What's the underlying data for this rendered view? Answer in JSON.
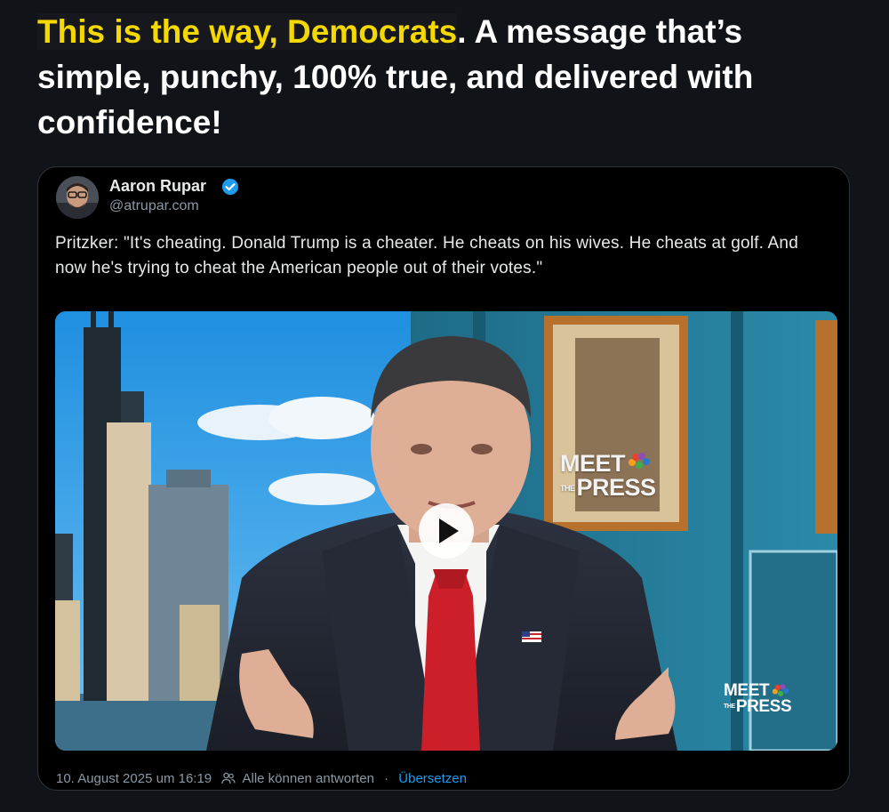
{
  "headline": {
    "highlight": "This is the way, Democrats",
    "rest": ". A message that’s simple, punchy, 100% true, and delivered with confidence!"
  },
  "post": {
    "author_name": "Aaron Rupar",
    "author_handle": "@atrupar.com",
    "verified": true,
    "text": "Pritzker: \"It's cheating. Donald Trump is a cheater. He cheats on his wives. He cheats at golf. And now he's trying to cheat the American people out of their votes.\"",
    "video": {
      "logo_line1": "MEET",
      "logo_the": "THE",
      "logo_line2": "PRESS",
      "play_icon": "play-icon"
    },
    "footer": {
      "timestamp": "10. August 2025 um 16:19",
      "replies_label": "Alle können antworten",
      "separator": "·",
      "translate_label": "Übersetzen"
    }
  },
  "colors": {
    "background": "#101318",
    "highlight": "#f5d800",
    "card_bg": "#000000",
    "card_border": "#2f3336",
    "link_blue": "#1d9bf0",
    "muted_text": "#8b98a5",
    "verified_blue": "#1d9bf0"
  }
}
